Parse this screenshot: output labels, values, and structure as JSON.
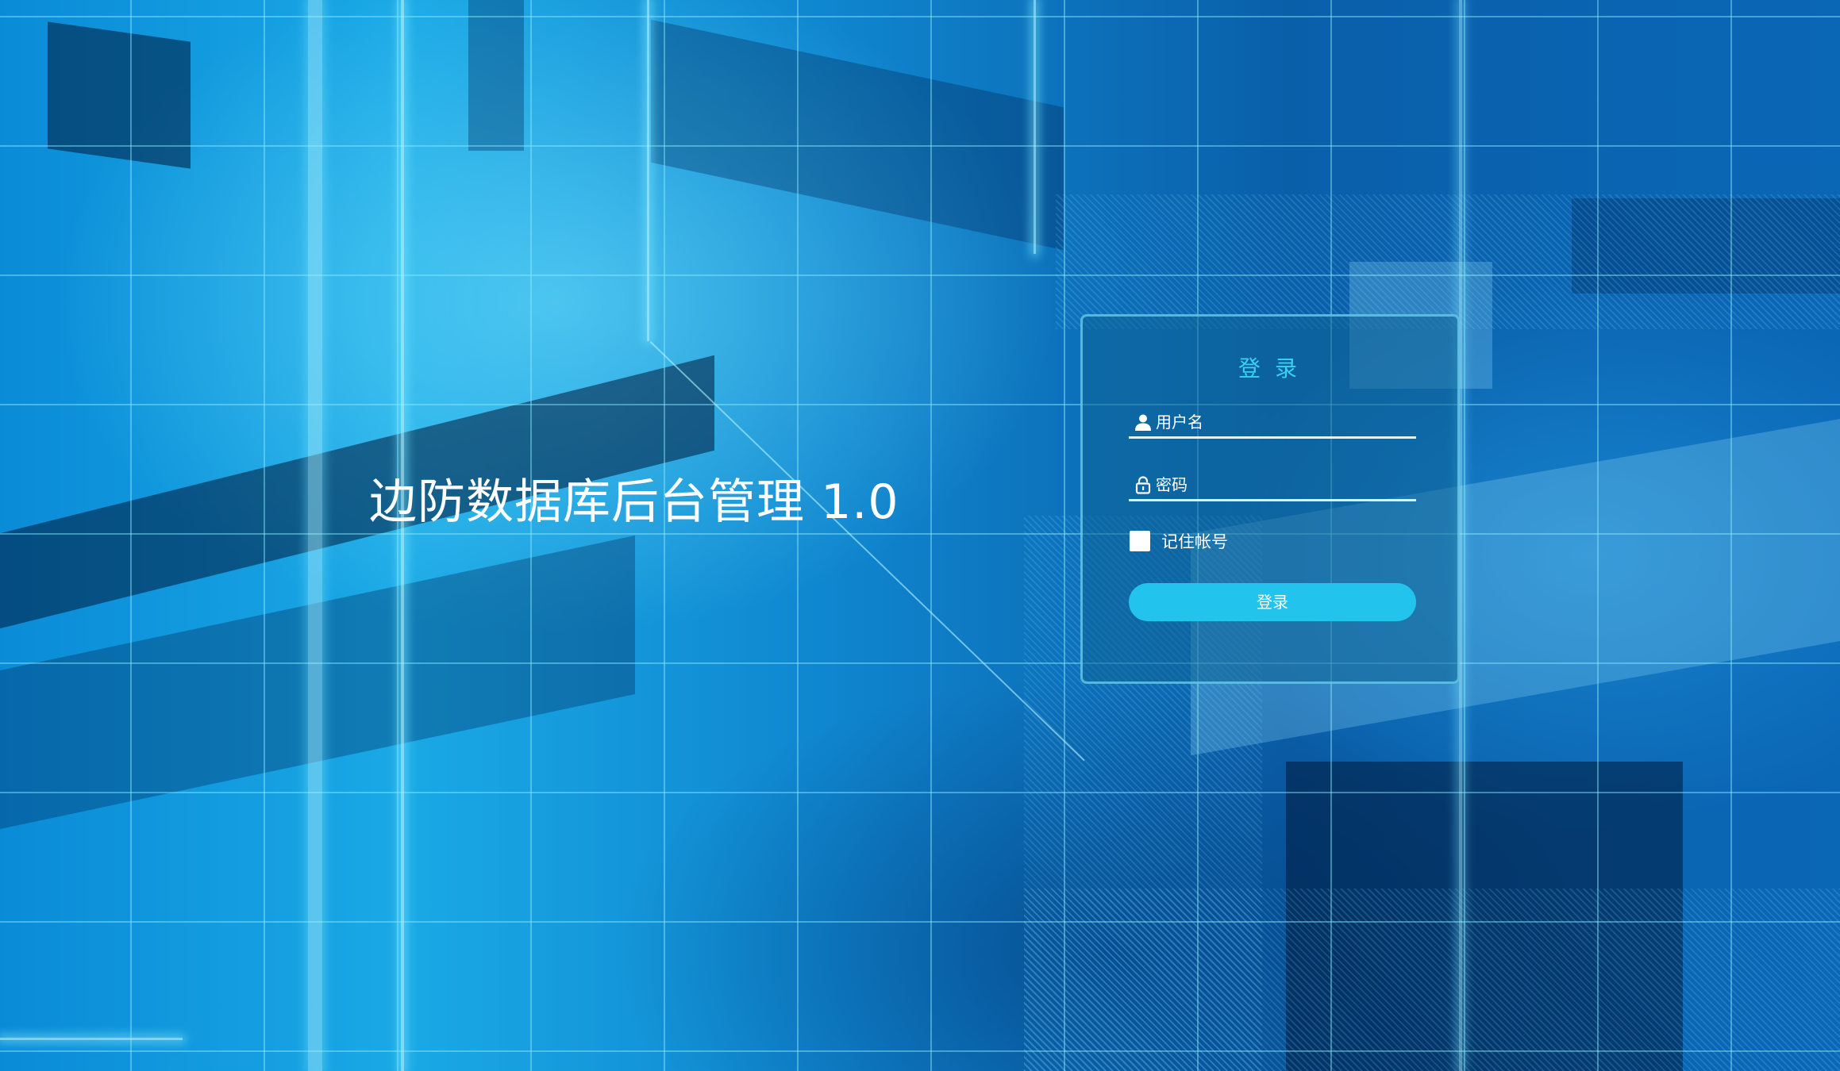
{
  "system_title": "边防数据库后台管理 1.0",
  "login": {
    "title": "登录",
    "username_placeholder": "用户名",
    "password_placeholder": "密码",
    "remember_label": "记住帐号",
    "submit_label": "登录"
  },
  "icons": {
    "username": "user-icon",
    "password": "lock-icon"
  },
  "colors": {
    "accent": "#22c3ed",
    "title_accent": "#3ad0f2",
    "panel_border": "#6ed2f0"
  }
}
